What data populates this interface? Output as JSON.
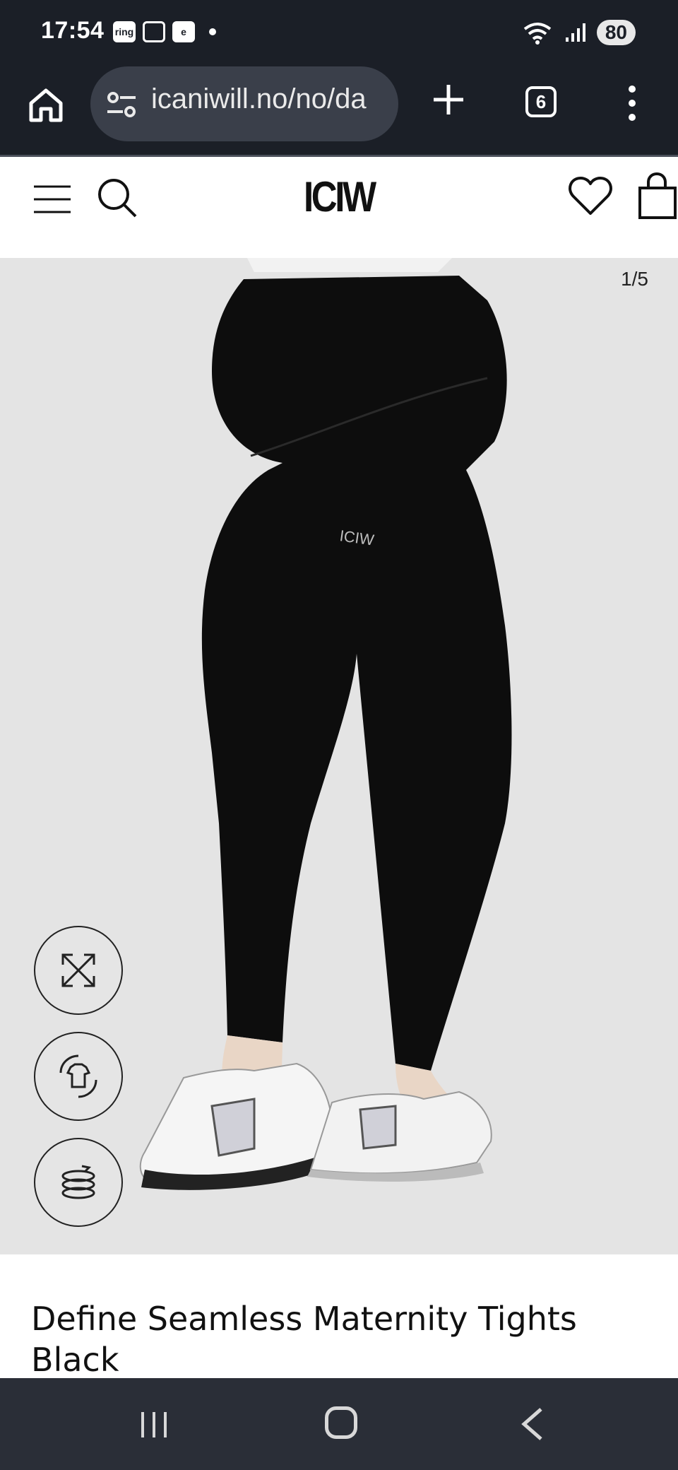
{
  "status_bar": {
    "time": "17:54",
    "left_icons": [
      "ring-app-icon",
      "screenshot-icon",
      "e-app-icon"
    ],
    "battery": "80"
  },
  "browser": {
    "url": "icaniwill.no/no/da",
    "tab_count": "6"
  },
  "site_header": {
    "logo": "ICIW"
  },
  "gallery": {
    "counter": "1/5",
    "logo_on_product": "ICIW",
    "tools": [
      "expand-icon",
      "shirt-rotate-icon",
      "360-view-icon"
    ]
  },
  "product": {
    "title": "Define Seamless Maternity Tights Black"
  },
  "colors": {
    "status_bar_bg": "#1b1f27",
    "url_bar_bg": "#3a3f4a",
    "gallery_bg": "#e4e4e4",
    "nav_bar_bg": "#2a2e37"
  }
}
